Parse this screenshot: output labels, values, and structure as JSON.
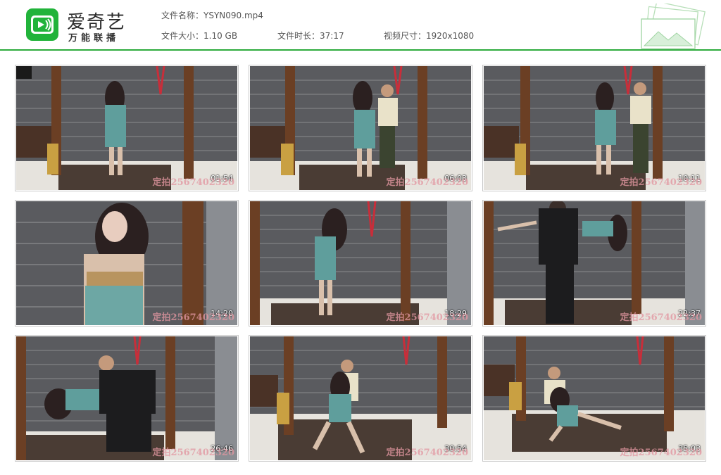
{
  "header": {
    "app_title": "爱奇艺",
    "app_subtitle": "万能联播",
    "file_name": "文件名称：YSYN090.mp4",
    "file_size": "文件大小：1.10 GB",
    "duration": "文件时长：37:17",
    "resolution": "视频尺寸：1920x1080"
  },
  "colors": {
    "accent": "#2dab3c",
    "wall": "#5a5b5f",
    "floor": "#e6e3dd"
  },
  "thumbnails": [
    {
      "time": "01:54",
      "watermark": "定拍2567402320"
    },
    {
      "time": "06:03",
      "watermark": "定拍2567402320"
    },
    {
      "time": "10:11",
      "watermark": "定拍2567402320"
    },
    {
      "time": "14:20",
      "watermark": "定拍2567402320"
    },
    {
      "time": "18:29",
      "watermark": "定拍2567402320"
    },
    {
      "time": "22:37",
      "watermark": "定拍2567402320"
    },
    {
      "time": "26:46",
      "watermark": "定拍2567402320"
    },
    {
      "time": "30:54",
      "watermark": "定拍2567402320"
    },
    {
      "time": "35:03",
      "watermark": "定拍2567402320"
    }
  ]
}
